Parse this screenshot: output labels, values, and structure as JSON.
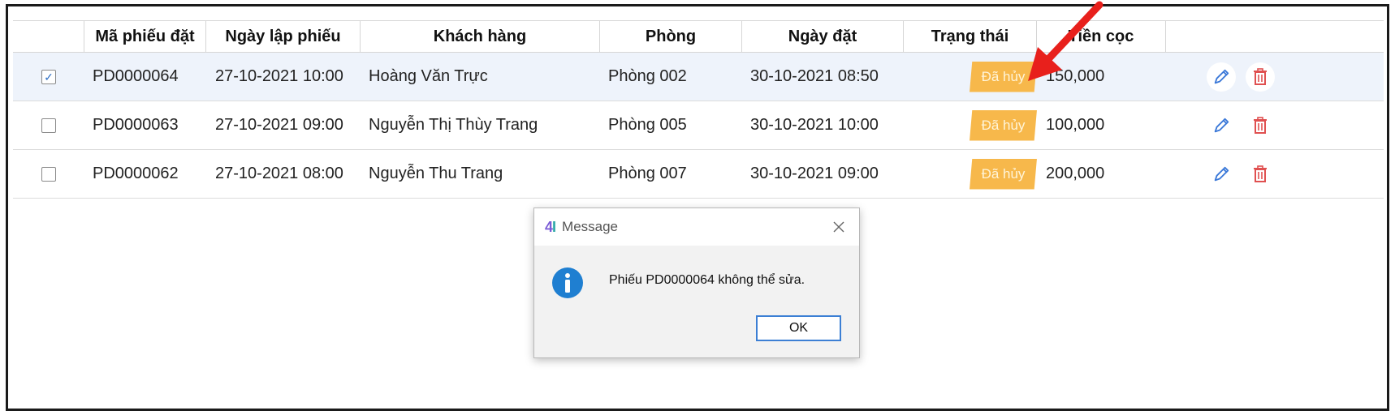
{
  "table": {
    "headers": [
      "",
      "Mã phiếu đặt",
      "Ngày lập phiếu",
      "Khách hàng",
      "Phòng",
      "Ngày đặt",
      "Trạng thái",
      "Tiền cọc",
      ""
    ],
    "rows": [
      {
        "checked": true,
        "check_mark": "✓",
        "code": "PD0000064",
        "created": "27-10-2021 10:00",
        "customer": "Hoàng Văn Trực",
        "room": "Phòng 002",
        "booking_date": "30-10-2021 08:50",
        "status": "Đã hủy",
        "deposit": "150,000"
      },
      {
        "checked": false,
        "check_mark": "",
        "code": "PD0000063",
        "created": "27-10-2021 09:00",
        "customer": "Nguyễn Thị Thùy Trang",
        "room": "Phòng 005",
        "booking_date": "30-10-2021 10:00",
        "status": "Đã hủy",
        "deposit": "100,000"
      },
      {
        "checked": false,
        "check_mark": "",
        "code": "PD0000062",
        "created": "27-10-2021 08:00",
        "customer": "Nguyễn Thu Trang",
        "room": "Phòng 007",
        "booking_date": "30-10-2021 09:00",
        "status": "Đã hủy",
        "deposit": "200,000"
      }
    ],
    "icons": {
      "edit": "pencil-icon",
      "delete": "trash-icon"
    }
  },
  "dialog": {
    "logo_a": "4",
    "logo_b": "I",
    "title": "Message",
    "message": "Phiếu PD0000064 không thể sửa.",
    "ok_label": "OK",
    "icon": "info-icon"
  },
  "colors": {
    "status_badge": "#f7b84b",
    "selected_row": "#eef3fb",
    "edit_icon": "#3a78d8",
    "delete_icon": "#e05050",
    "arrow": "#e8201c",
    "info_icon": "#1f7fd1"
  }
}
